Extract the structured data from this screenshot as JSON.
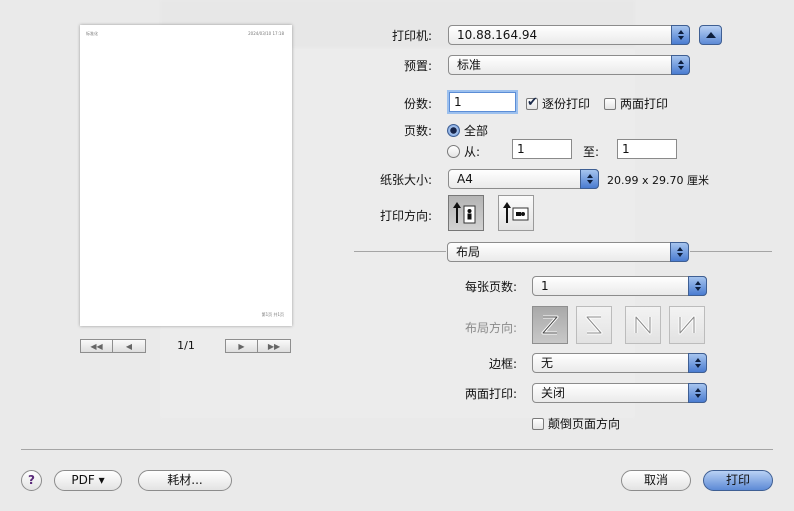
{
  "preview": {
    "header_left": "标准化",
    "header_right": "2024/03/10 17:18",
    "footer": "第1页 共1页",
    "page_counter": "1/1",
    "nav": [
      "◀◀",
      "◀",
      "▶",
      "▶▶"
    ]
  },
  "printer": {
    "label": "打印机:",
    "value": "10.88.164.94"
  },
  "presets": {
    "label": "预置:",
    "value": "标准"
  },
  "copies": {
    "label": "份数:",
    "value": "1",
    "collate_label": "逐份打印",
    "collate": true,
    "two_sided_label": "两面打印",
    "two_sided": false
  },
  "pages": {
    "label": "页数:",
    "all_label": "全部",
    "all_selected": true,
    "from_label": "从:",
    "from_value": "1",
    "to_label": "至:",
    "to_value": "1"
  },
  "paper_size": {
    "label": "纸张大小:",
    "value": "A4",
    "dimensions": "20.99 x 29.70 厘米"
  },
  "orientation": {
    "label": "打印方向:",
    "selected": "portrait"
  },
  "section": {
    "value": "布局"
  },
  "layout": {
    "pages_per_sheet_label": "每张页数:",
    "pages_per_sheet": "1",
    "direction_label": "布局方向:",
    "border_label": "边框:",
    "border": "无",
    "two_sided_label": "两面打印:",
    "two_sided": "关闭",
    "reverse_label": "颠倒页面方向",
    "reverse": false
  },
  "footer": {
    "help": "?",
    "pdf": "PDF ▾",
    "supplies": "耗材...",
    "cancel": "取消",
    "print": "打印"
  },
  "colors": {
    "accent": "#5d8ad6"
  }
}
